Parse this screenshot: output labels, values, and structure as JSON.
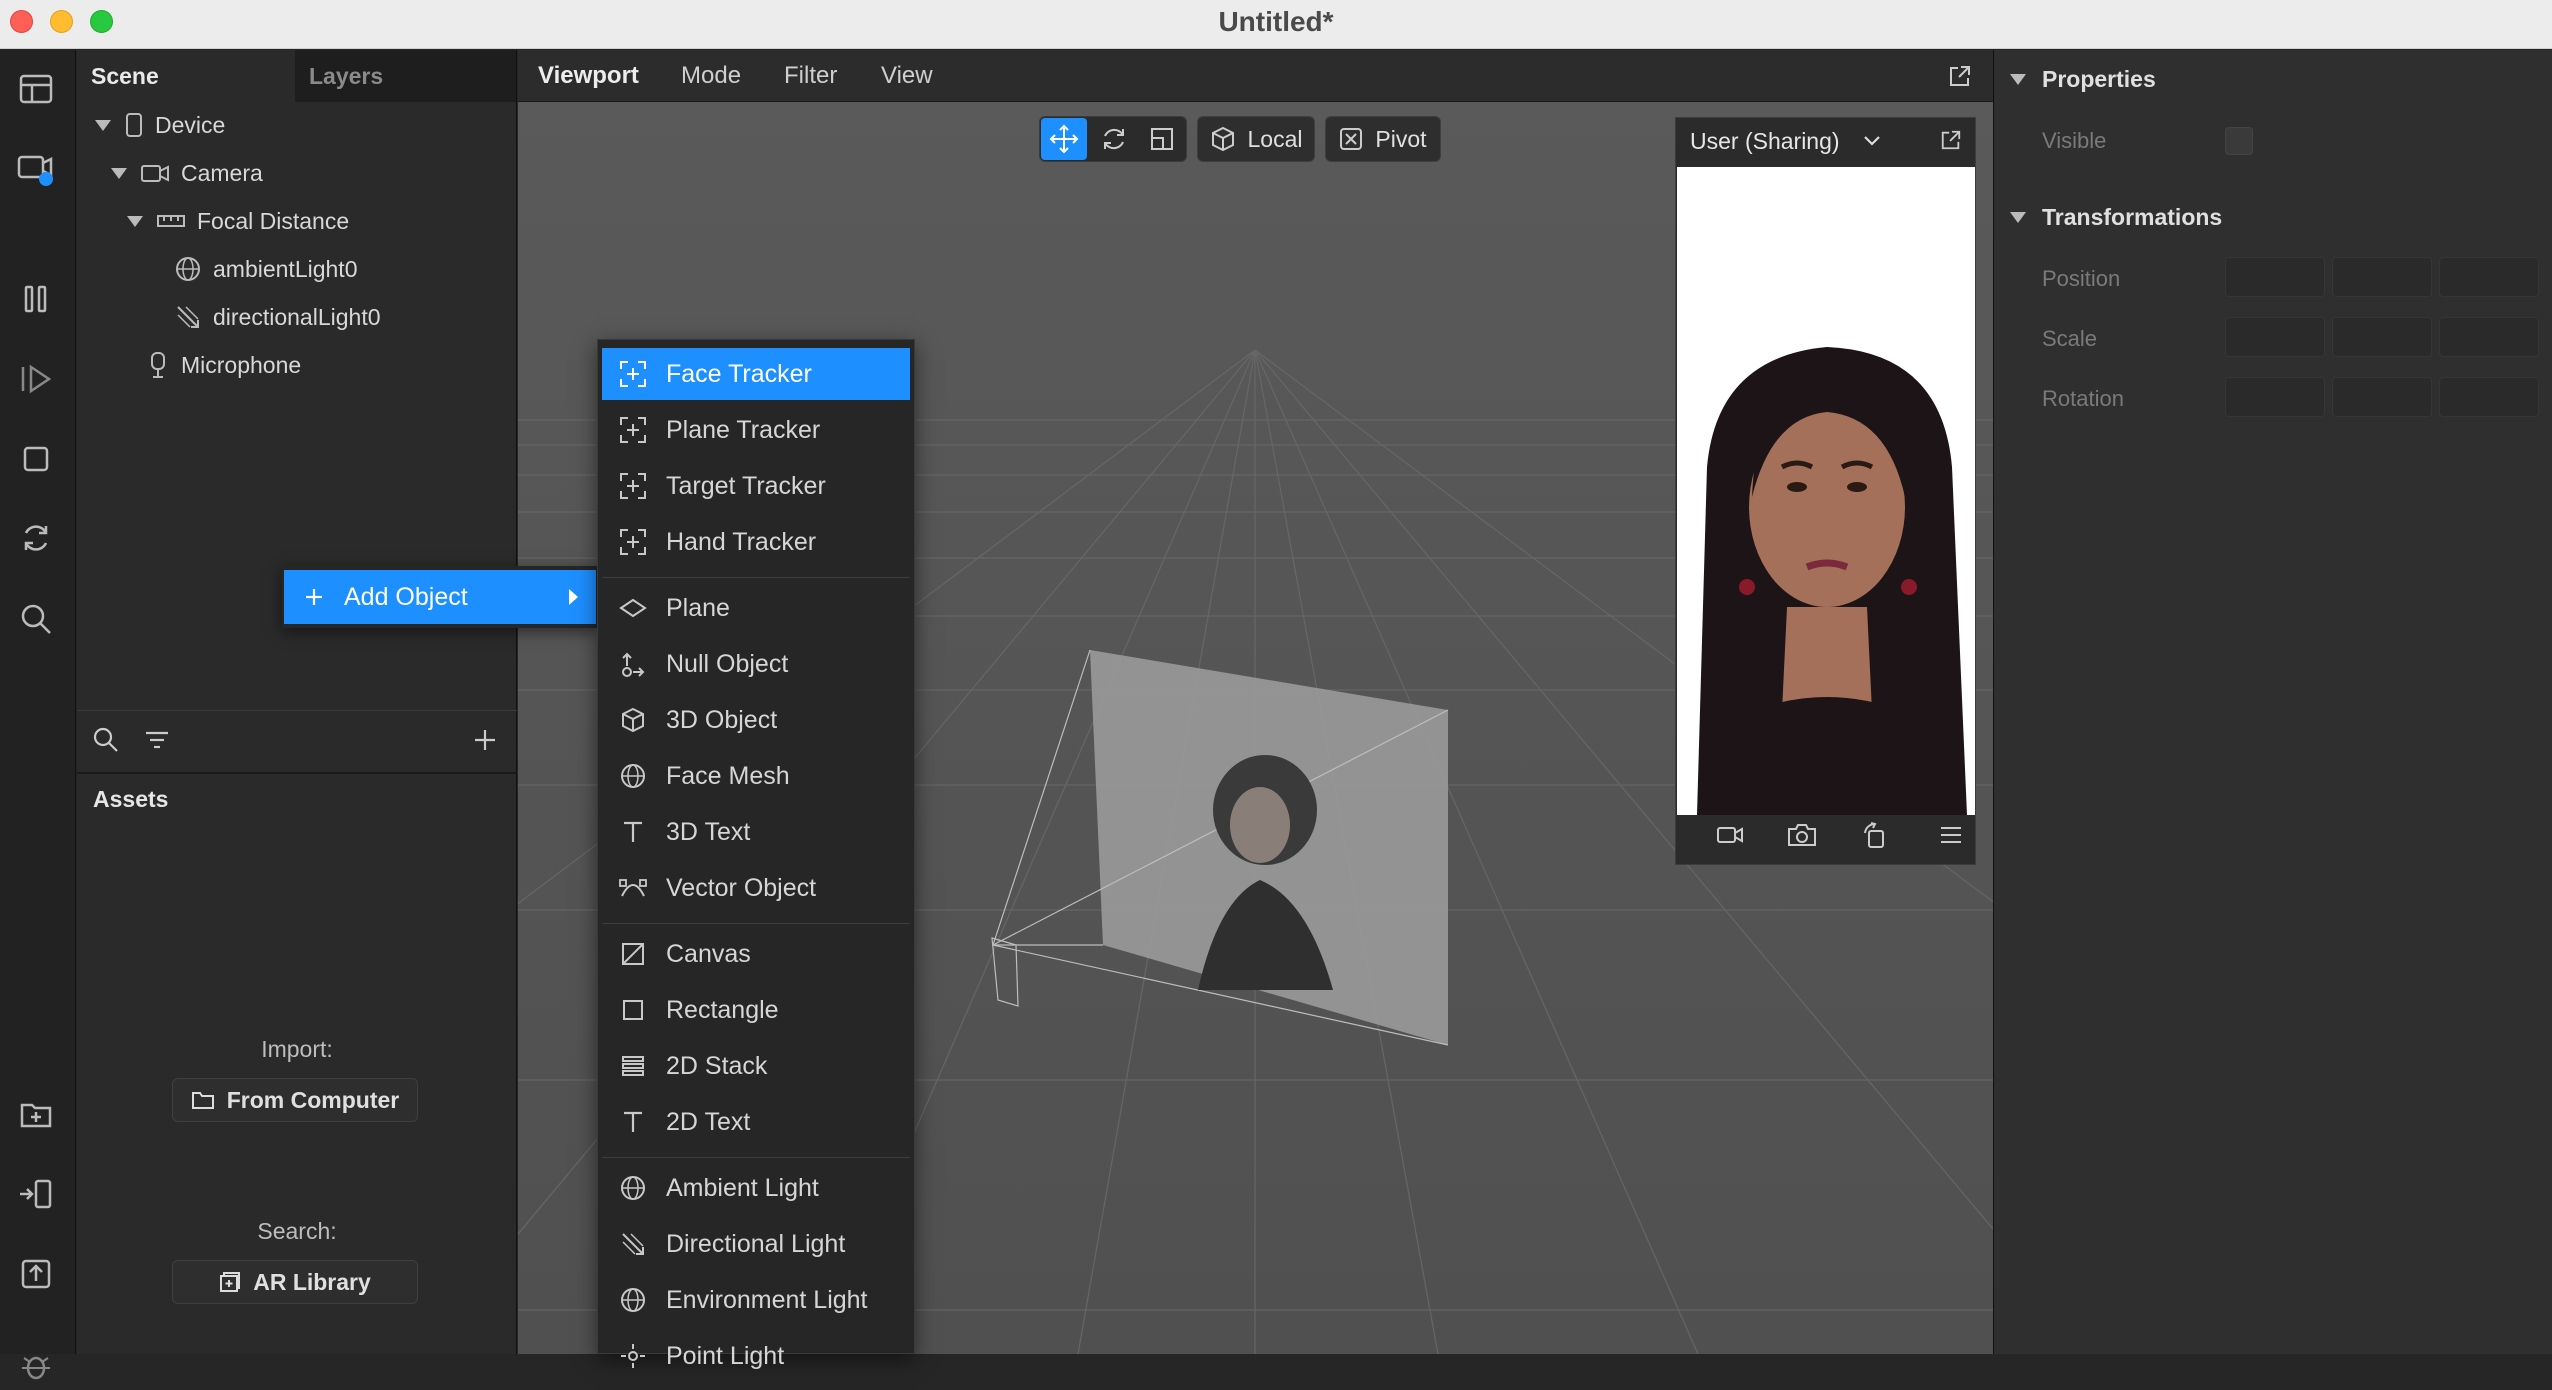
{
  "window": {
    "title": "Untitled*"
  },
  "scene_panel": {
    "tabs": [
      "Scene",
      "Layers"
    ],
    "tree": [
      {
        "label": "Device",
        "icon": "phone-icon",
        "expanded": true
      },
      {
        "label": "Camera",
        "icon": "camera-icon",
        "expanded": true
      },
      {
        "label": "Focal Distance",
        "icon": "ruler-icon",
        "expanded": true
      },
      {
        "label": "ambientLight0",
        "icon": "globe-icon"
      },
      {
        "label": "directionalLight0",
        "icon": "directional-light-icon"
      },
      {
        "label": "Microphone",
        "icon": "microphone-icon"
      }
    ]
  },
  "context_menu": {
    "label": "Add Object"
  },
  "assets": {
    "title": "Assets",
    "import_label": "Import:",
    "import_button": "From Computer",
    "search_label": "Search:",
    "search_button": "AR Library"
  },
  "viewport": {
    "tabs": [
      "Viewport",
      "Mode",
      "Filter",
      "View"
    ],
    "toolbar": {
      "local": "Local",
      "pivot": "Pivot"
    },
    "preview": {
      "device": "User (Sharing)"
    }
  },
  "submenu": {
    "groups": [
      [
        {
          "label": "Face Tracker",
          "icon": "tracker-icon",
          "selected": true
        },
        {
          "label": "Plane Tracker",
          "icon": "tracker-icon"
        },
        {
          "label": "Target Tracker",
          "icon": "tracker-icon"
        },
        {
          "label": "Hand Tracker",
          "icon": "tracker-icon"
        }
      ],
      [
        {
          "label": "Plane",
          "icon": "plane-icon"
        },
        {
          "label": "Null Object",
          "icon": "null-object-icon"
        },
        {
          "label": "3D Object",
          "icon": "cube-icon"
        },
        {
          "label": "Face Mesh",
          "icon": "globe-icon"
        },
        {
          "label": "3D Text",
          "icon": "text-icon"
        },
        {
          "label": "Vector Object",
          "icon": "vector-icon"
        }
      ],
      [
        {
          "label": "Canvas",
          "icon": "canvas-icon"
        },
        {
          "label": "Rectangle",
          "icon": "rectangle-icon"
        },
        {
          "label": "2D Stack",
          "icon": "stack-icon"
        },
        {
          "label": "2D Text",
          "icon": "text-icon"
        }
      ],
      [
        {
          "label": "Ambient Light",
          "icon": "globe-icon"
        },
        {
          "label": "Directional Light",
          "icon": "directional-light-icon"
        },
        {
          "label": "Environment Light",
          "icon": "globe-icon"
        },
        {
          "label": "Point Light",
          "icon": "point-light-icon"
        }
      ]
    ]
  },
  "properties": {
    "title": "Properties",
    "visible_label": "Visible",
    "transform_title": "Transformations",
    "rows": [
      "Position",
      "Scale",
      "Rotation"
    ]
  },
  "colors": {
    "accent": "#1e8fff",
    "menu_bg": "#262626",
    "viewport_bg": "#555555"
  }
}
